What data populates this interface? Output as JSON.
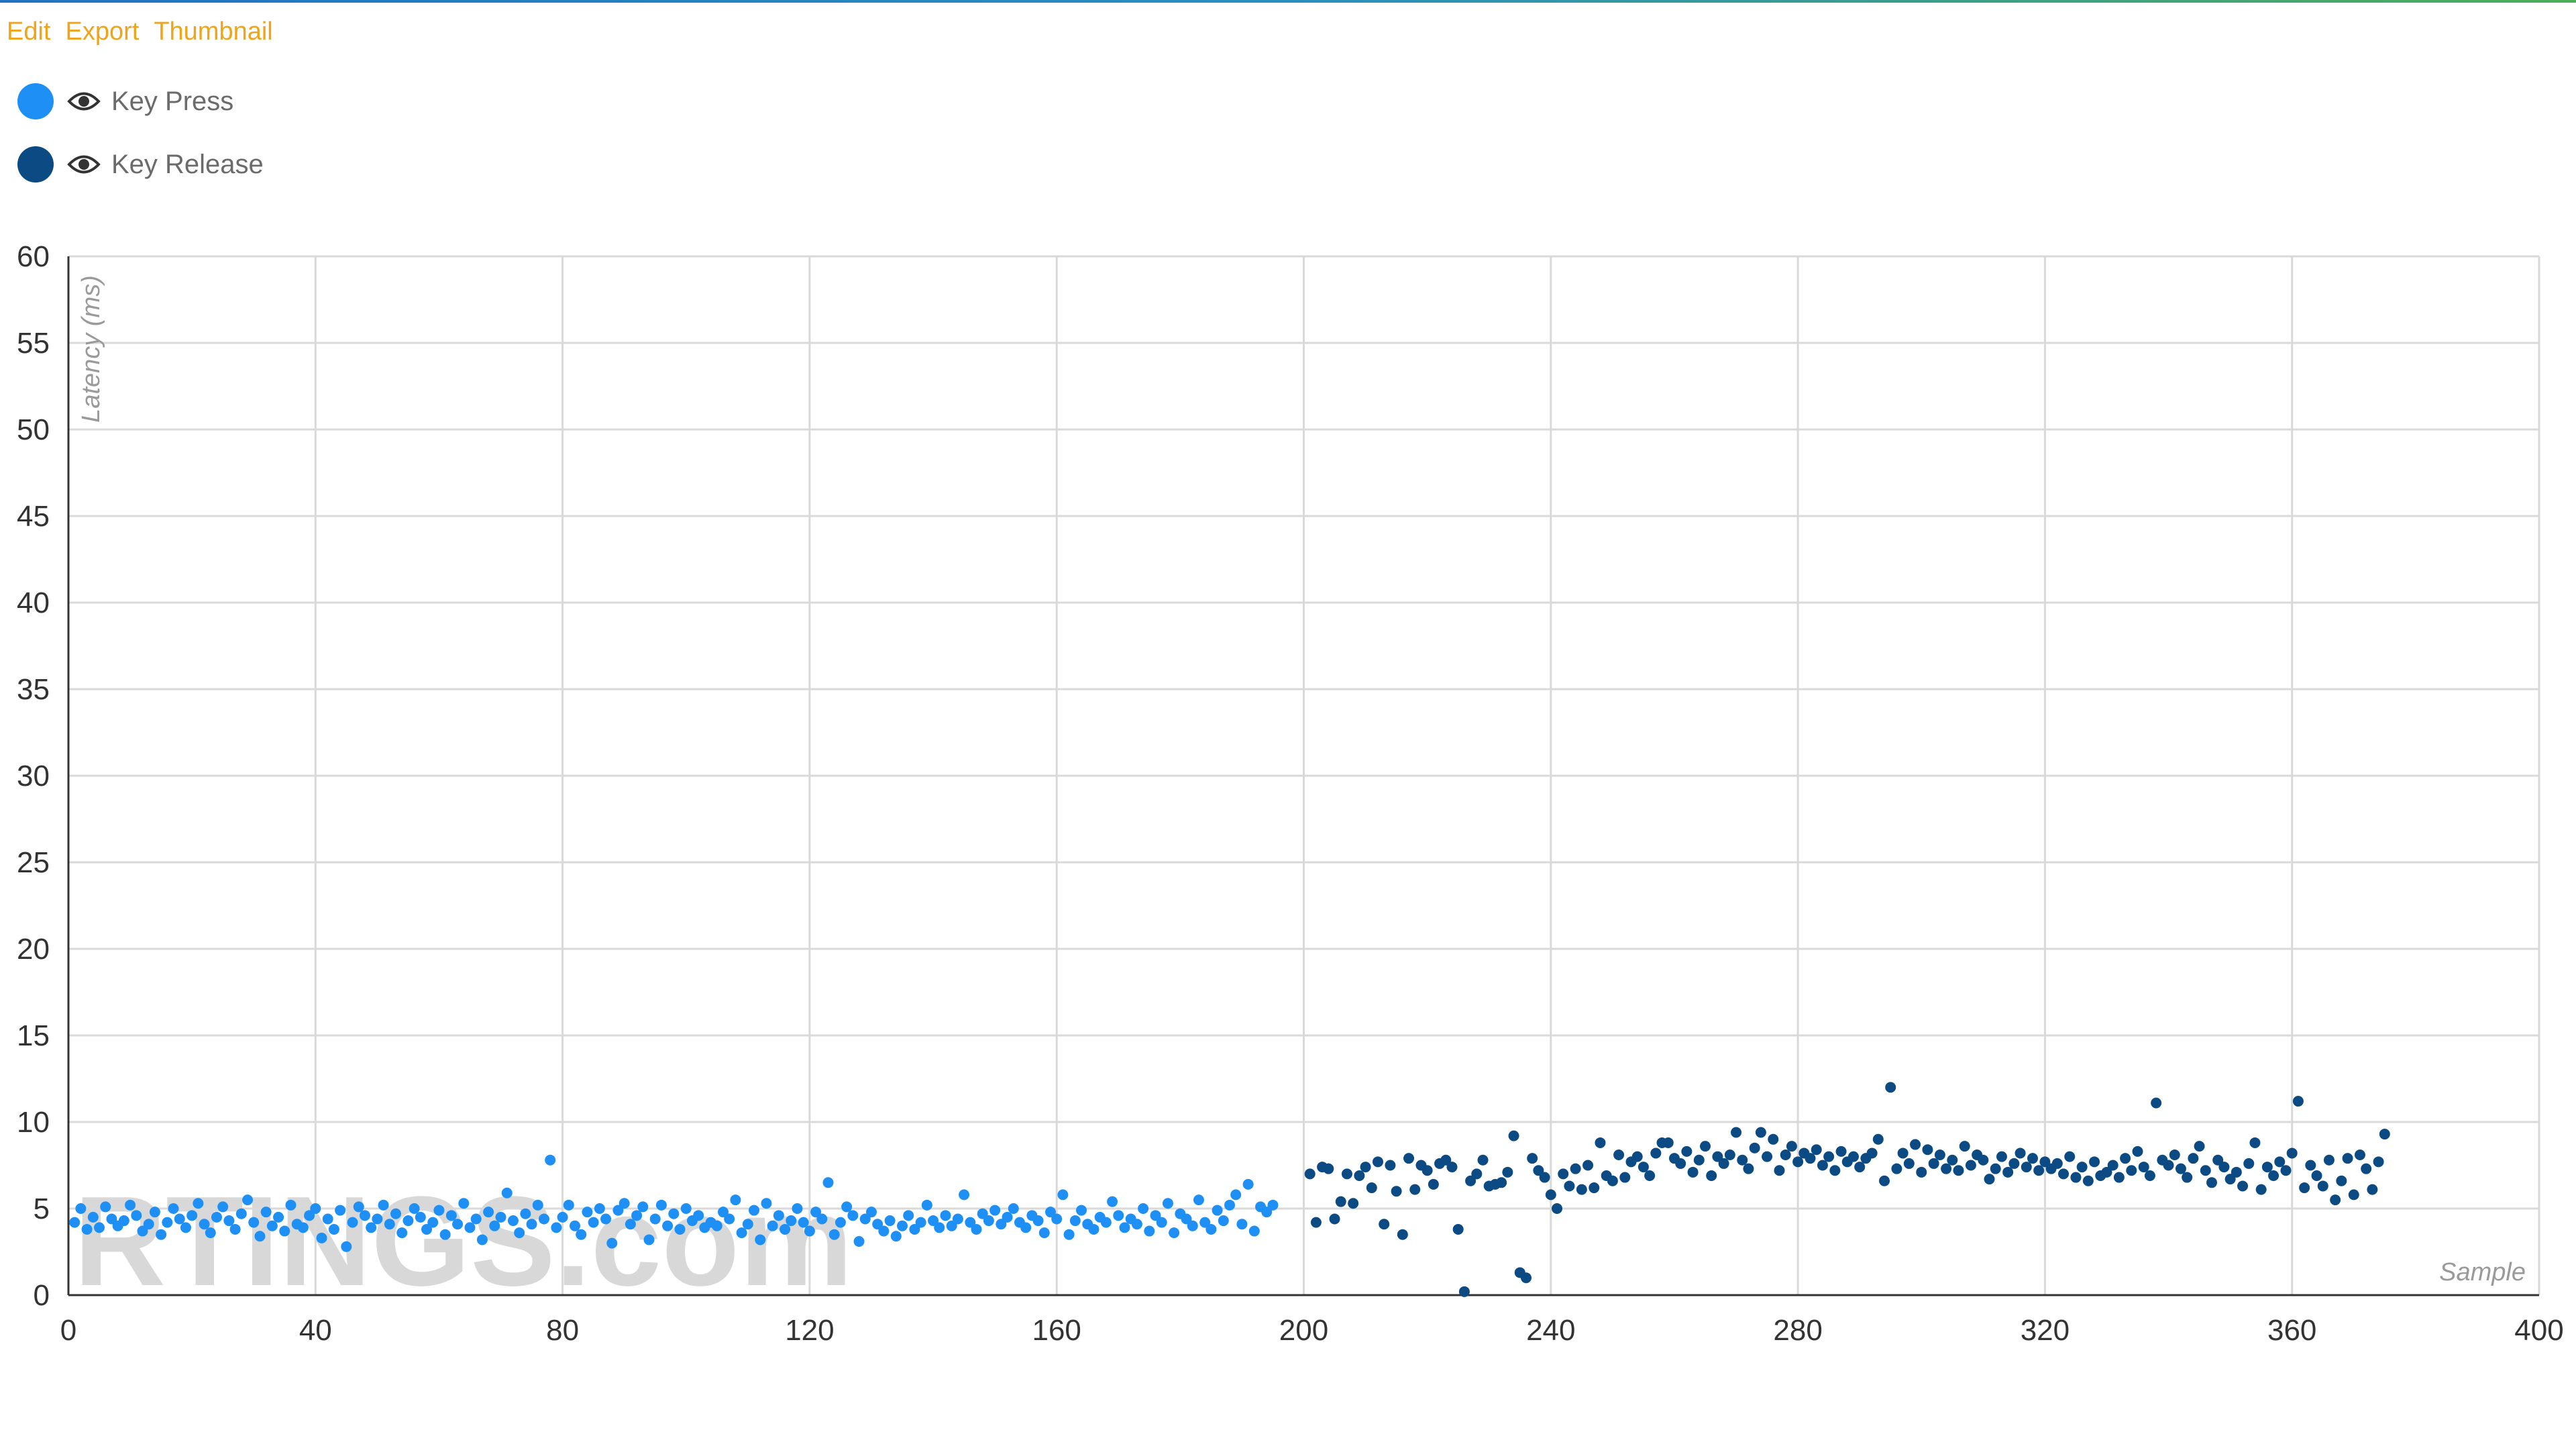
{
  "toolbar": {
    "edit_label": "Edit",
    "export_label": "Export",
    "thumbnail_label": "Thumbnail",
    "color": "#f0a419"
  },
  "legend": {
    "items": [
      {
        "label": "Key Press",
        "color": "#1e90f5",
        "icon": "eye-icon"
      },
      {
        "label": "Key Release",
        "color": "#0b4a82",
        "icon": "eye-icon"
      }
    ]
  },
  "watermark": "RTINGS.com",
  "chart_data": {
    "type": "scatter",
    "title": "",
    "xlabel": "Sample",
    "ylabel": "Latency (ms)",
    "xlim": [
      0,
      400
    ],
    "ylim": [
      0,
      60
    ],
    "xticks": [
      0,
      40,
      80,
      120,
      160,
      200,
      240,
      280,
      320,
      360,
      400
    ],
    "yticks": [
      0,
      5,
      10,
      15,
      20,
      25,
      30,
      35,
      40,
      45,
      50,
      55,
      60
    ],
    "grid": true,
    "series": [
      {
        "name": "Key Press",
        "color": "#1e90f5",
        "x_start": 1,
        "y": [
          4.2,
          5,
          3.8,
          4.5,
          3.9,
          5.1,
          4.4,
          4,
          4.3,
          5.2,
          4.6,
          3.7,
          4.1,
          4.8,
          3.5,
          4.2,
          5,
          4.4,
          3.9,
          4.6,
          5.3,
          4.1,
          3.6,
          4.5,
          5.1,
          4.3,
          3.8,
          4.7,
          5.5,
          4.2,
          3.4,
          4.8,
          4,
          4.5,
          3.7,
          5.2,
          4.1,
          3.9,
          4.6,
          5,
          3.3,
          4.4,
          3.8,
          4.9,
          2.8,
          4.2,
          5.1,
          4.6,
          3.9,
          4.4,
          5.2,
          4.1,
          4.7,
          3.6,
          4.3,
          5,
          4.5,
          3.8,
          4.2,
          4.9,
          3.5,
          4.6,
          4.1,
          5.3,
          3.9,
          4.4,
          3.2,
          4.8,
          4,
          4.5,
          5.9,
          4.3,
          3.6,
          4.7,
          4.1,
          5.2,
          4.4,
          7.8,
          3.9,
          4.5,
          5.2,
          4,
          3.5,
          4.8,
          4.2,
          5,
          4.4,
          3,
          4.9,
          5.3,
          4.1,
          4.6,
          5.1,
          3.2,
          4.4,
          5.2,
          4,
          4.7,
          3.8,
          5,
          4.3,
          4.6,
          3.9,
          4.2,
          4,
          4.8,
          4.4,
          5.5,
          3.6,
          4.1,
          4.9,
          3.2,
          5.3,
          4,
          4.6,
          3.8,
          4.3,
          5,
          4.2,
          3.7,
          4.8,
          4.4,
          6.5,
          3.5,
          4.2,
          5.1,
          4.6,
          3.1,
          4.4,
          4.8,
          4.1,
          3.7,
          4.3,
          3.4,
          4,
          4.6,
          3.8,
          4.2,
          5.2,
          4.3,
          3.9,
          4.6,
          4,
          4.4,
          5.8,
          4.2,
          3.8,
          4.7,
          4.3,
          4.9,
          4.1,
          4.5,
          5,
          4.2,
          3.9,
          4.6,
          4.3,
          3.6,
          4.8,
          4.4,
          5.8,
          3.5,
          4.3,
          4.9,
          4.1,
          3.8,
          4.5,
          4.2,
          5.4,
          4.6,
          3.9,
          4.4,
          4.1,
          5,
          3.7,
          4.6,
          4.2,
          5.3,
          3.6,
          4.7,
          4.4,
          4,
          5.5,
          4.2,
          3.8,
          4.9,
          4.3,
          5.2,
          5.8,
          4.1,
          6.4,
          3.7,
          5.1,
          4.8,
          5.2
        ]
      },
      {
        "name": "Key Release",
        "color": "#0b4a82",
        "x_start": 201,
        "y": [
          7,
          4.2,
          7.4,
          7.3,
          4.4,
          5.4,
          7,
          5.3,
          6.9,
          7.4,
          6.2,
          7.7,
          4.1,
          7.5,
          6,
          3.5,
          7.9,
          6.1,
          7.5,
          7.2,
          6.4,
          7.6,
          7.8,
          7.4,
          3.8,
          0.2,
          6.6,
          7,
          7.8,
          6.3,
          6.4,
          6.5,
          7.1,
          9.2,
          1.3,
          1,
          7.9,
          7.2,
          6.8,
          5.8,
          5,
          7,
          6.3,
          7.3,
          6.1,
          7.5,
          6.2,
          8.8,
          6.9,
          6.6,
          8.1,
          6.8,
          7.7,
          8,
          7.4,
          6.9,
          8.2,
          8.8,
          8.8,
          7.9,
          7.6,
          8.3,
          7.1,
          7.8,
          8.6,
          6.9,
          8,
          7.6,
          8.1,
          9.4,
          7.8,
          7.3,
          8.5,
          9.4,
          8,
          9,
          7.2,
          8.1,
          8.6,
          7.7,
          8.2,
          7.9,
          8.4,
          7.5,
          8,
          7.2,
          8.3,
          7.7,
          8,
          7.4,
          7.9,
          8.2,
          9,
          6.6,
          12,
          7.3,
          8.2,
          7.6,
          8.7,
          7.1,
          8.4,
          7.6,
          8.1,
          7.3,
          7.8,
          7.2,
          8.6,
          7.5,
          8.1,
          7.8,
          6.7,
          7.3,
          8,
          7.1,
          7.6,
          8.2,
          7.4,
          7.9,
          7.2,
          7.7,
          7.3,
          7.6,
          7,
          8,
          6.8,
          7.4,
          6.6,
          7.7,
          6.9,
          7.1,
          7.5,
          6.8,
          7.9,
          7.2,
          8.3,
          7.4,
          6.9,
          11.1,
          7.8,
          7.5,
          8.1,
          7.3,
          6.8,
          7.9,
          8.6,
          7.2,
          6.5,
          7.8,
          7.4,
          6.7,
          7.1,
          6.3,
          7.6,
          8.8,
          6.1,
          7.4,
          6.9,
          7.7,
          7.2,
          8.2,
          11.2,
          6.2,
          7.5,
          6.9,
          6.3,
          7.8,
          5.5,
          6.6,
          7.9,
          5.8,
          8.1,
          7.3,
          6.1,
          7.7,
          9.3
        ]
      }
    ]
  }
}
